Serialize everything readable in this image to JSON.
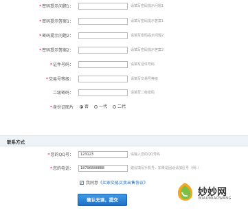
{
  "security": {
    "rows": [
      {
        "label": "密码提示问题1：",
        "required": true,
        "value": "",
        "hint": "请填写密码提示问题1"
      },
      {
        "label": "密码提示答案1：",
        "required": true,
        "value": "",
        "hint": "请填写密码提示答案1"
      },
      {
        "label": "密码提示问题2：",
        "required": true,
        "value": "",
        "hint": "请填写密码提示问题2"
      },
      {
        "label": "密码提示答案2：",
        "required": true,
        "value": "",
        "hint": "请填写密码提示答案2"
      },
      {
        "label": "证件号码：",
        "required": true,
        "value": "",
        "hint": "请填写证件号码"
      },
      {
        "label": "交易号等级：",
        "required": true,
        "value": "",
        "hint": "请填写交易号等级"
      },
      {
        "label": "二级密码：",
        "required": false,
        "value": "",
        "hint": "请填写二级密码"
      }
    ],
    "id_photo": {
      "label": "身份证图片",
      "required": true,
      "options": [
        "否",
        "一代",
        "二代"
      ],
      "selected": 0
    }
  },
  "contact": {
    "section_title": "联系方式",
    "qq": {
      "label": "您的QQ号：",
      "value": "123123",
      "hint": "请输入您的QQ号码"
    },
    "phone": {
      "label": "您的电话：",
      "value": "18796888888",
      "hint": "建议填写手机号，如果是固话请加区号（例：）"
    }
  },
  "agreement": {
    "prefix": "我同意",
    "link": "《买家交易买卖出售协议》",
    "checked": true
  },
  "submit_label": "确认无误，提交",
  "watermark": {
    "title": "妙妙网",
    "subtitle": "MIAOMIAOWANG"
  }
}
